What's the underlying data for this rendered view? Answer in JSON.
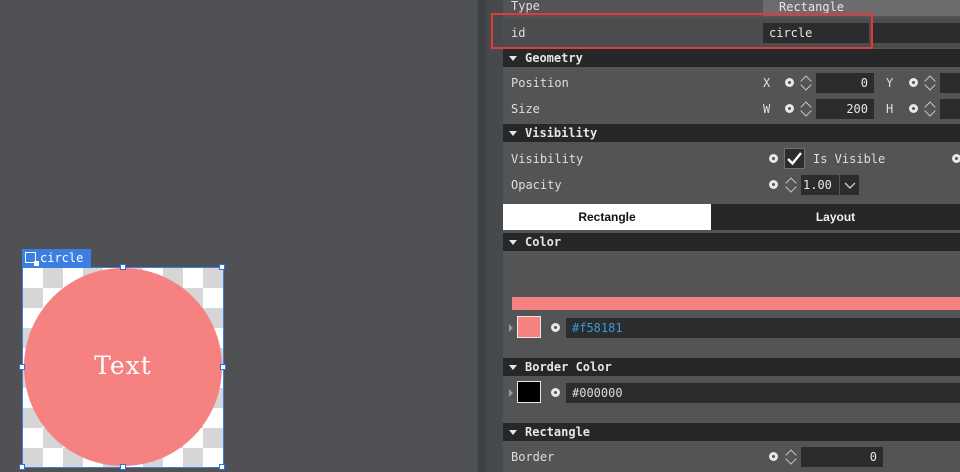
{
  "canvas": {
    "chip_label": "circle",
    "circle_text": "Text"
  },
  "props": {
    "type_label": "Type",
    "type_value": "Rectangle",
    "id_label": "id",
    "id_value": "circle",
    "geometry": {
      "title": "Geometry",
      "position_label": "Position",
      "x_axis": "X",
      "x_value": "0",
      "y_axis": "Y",
      "size_label": "Size",
      "w_axis": "W",
      "w_value": "200",
      "h_axis": "H"
    },
    "visibility": {
      "title": "Visibility",
      "visibility_label": "Visibility",
      "is_visible_label": "Is Visible",
      "is_visible_checked": true,
      "opacity_label": "Opacity",
      "opacity_value": "1.00"
    },
    "tabs": [
      "Rectangle",
      "Layout"
    ],
    "active_tab": "Rectangle",
    "color": {
      "title": "Color",
      "hex": "#f58181"
    },
    "border_color": {
      "title": "Border Color",
      "hex": "#000000"
    },
    "rectangle": {
      "title": "Rectangle",
      "border_label": "Border",
      "border_value": "0"
    }
  },
  "colors": {
    "accent": "#3d7fe0",
    "highlight": "#e53935",
    "fill": "#f58181",
    "border": "#000000",
    "link_text": "#3a9ad9"
  }
}
